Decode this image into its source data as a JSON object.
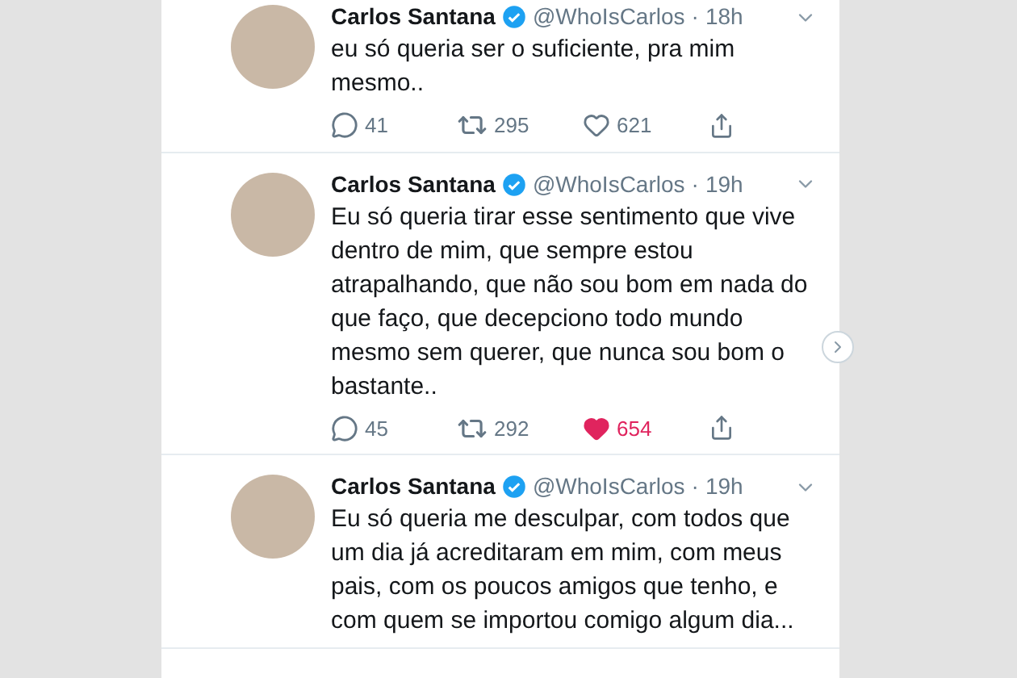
{
  "tweets": [
    {
      "name": "Carlos Santana",
      "handle": "@WhoIsCarlos",
      "dot": "·",
      "time": "18h",
      "text": "eu só queria ser o suficiente, pra mim mesmo..",
      "replies": "41",
      "retweets": "295",
      "likes": "621",
      "liked": false
    },
    {
      "name": "Carlos Santana",
      "handle": "@WhoIsCarlos",
      "dot": "·",
      "time": "19h",
      "text": "Eu só queria tirar esse sentimento que vive dentro de mim, que sempre estou atrapalhando, que não sou bom em nada do que faço, que decepciono todo mundo mesmo sem querer, que nunca sou bom o bastante..",
      "replies": "45",
      "retweets": "292",
      "likes": "654",
      "liked": true
    },
    {
      "name": "Carlos Santana",
      "handle": "@WhoIsCarlos",
      "dot": "·",
      "time": "19h",
      "text": "Eu só queria me desculpar, com todos que um dia já acreditaram em mim, com meus pais, com os poucos amigos que tenho, e com quem se importou comigo algum dia..."
    }
  ]
}
